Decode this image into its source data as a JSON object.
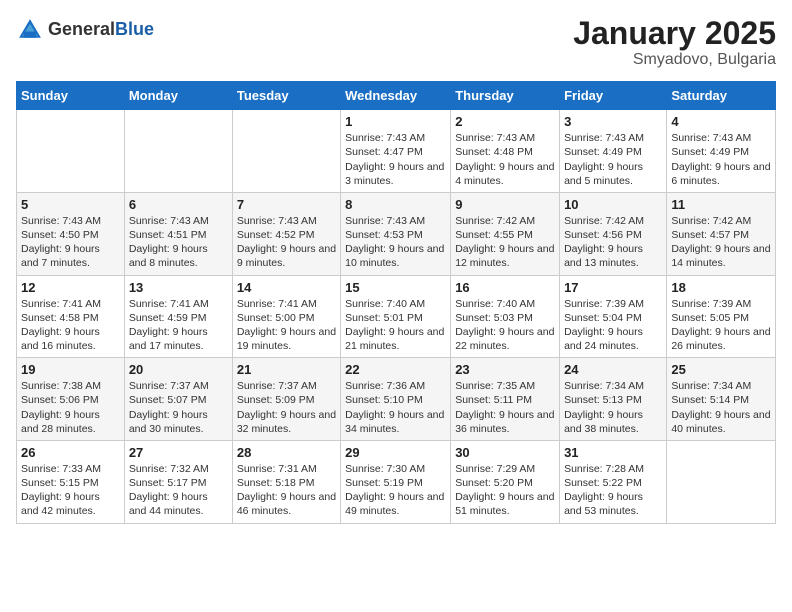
{
  "logo": {
    "text_general": "General",
    "text_blue": "Blue"
  },
  "title": "January 2025",
  "subtitle": "Smyadovo, Bulgaria",
  "weekdays": [
    "Sunday",
    "Monday",
    "Tuesday",
    "Wednesday",
    "Thursday",
    "Friday",
    "Saturday"
  ],
  "weeks": [
    [
      {
        "day": "",
        "text": ""
      },
      {
        "day": "",
        "text": ""
      },
      {
        "day": "",
        "text": ""
      },
      {
        "day": "1",
        "text": "Sunrise: 7:43 AM\nSunset: 4:47 PM\nDaylight: 9 hours and 3 minutes."
      },
      {
        "day": "2",
        "text": "Sunrise: 7:43 AM\nSunset: 4:48 PM\nDaylight: 9 hours and 4 minutes."
      },
      {
        "day": "3",
        "text": "Sunrise: 7:43 AM\nSunset: 4:49 PM\nDaylight: 9 hours and 5 minutes."
      },
      {
        "day": "4",
        "text": "Sunrise: 7:43 AM\nSunset: 4:49 PM\nDaylight: 9 hours and 6 minutes."
      }
    ],
    [
      {
        "day": "5",
        "text": "Sunrise: 7:43 AM\nSunset: 4:50 PM\nDaylight: 9 hours and 7 minutes."
      },
      {
        "day": "6",
        "text": "Sunrise: 7:43 AM\nSunset: 4:51 PM\nDaylight: 9 hours and 8 minutes."
      },
      {
        "day": "7",
        "text": "Sunrise: 7:43 AM\nSunset: 4:52 PM\nDaylight: 9 hours and 9 minutes."
      },
      {
        "day": "8",
        "text": "Sunrise: 7:43 AM\nSunset: 4:53 PM\nDaylight: 9 hours and 10 minutes."
      },
      {
        "day": "9",
        "text": "Sunrise: 7:42 AM\nSunset: 4:55 PM\nDaylight: 9 hours and 12 minutes."
      },
      {
        "day": "10",
        "text": "Sunrise: 7:42 AM\nSunset: 4:56 PM\nDaylight: 9 hours and 13 minutes."
      },
      {
        "day": "11",
        "text": "Sunrise: 7:42 AM\nSunset: 4:57 PM\nDaylight: 9 hours and 14 minutes."
      }
    ],
    [
      {
        "day": "12",
        "text": "Sunrise: 7:41 AM\nSunset: 4:58 PM\nDaylight: 9 hours and 16 minutes."
      },
      {
        "day": "13",
        "text": "Sunrise: 7:41 AM\nSunset: 4:59 PM\nDaylight: 9 hours and 17 minutes."
      },
      {
        "day": "14",
        "text": "Sunrise: 7:41 AM\nSunset: 5:00 PM\nDaylight: 9 hours and 19 minutes."
      },
      {
        "day": "15",
        "text": "Sunrise: 7:40 AM\nSunset: 5:01 PM\nDaylight: 9 hours and 21 minutes."
      },
      {
        "day": "16",
        "text": "Sunrise: 7:40 AM\nSunset: 5:03 PM\nDaylight: 9 hours and 22 minutes."
      },
      {
        "day": "17",
        "text": "Sunrise: 7:39 AM\nSunset: 5:04 PM\nDaylight: 9 hours and 24 minutes."
      },
      {
        "day": "18",
        "text": "Sunrise: 7:39 AM\nSunset: 5:05 PM\nDaylight: 9 hours and 26 minutes."
      }
    ],
    [
      {
        "day": "19",
        "text": "Sunrise: 7:38 AM\nSunset: 5:06 PM\nDaylight: 9 hours and 28 minutes."
      },
      {
        "day": "20",
        "text": "Sunrise: 7:37 AM\nSunset: 5:07 PM\nDaylight: 9 hours and 30 minutes."
      },
      {
        "day": "21",
        "text": "Sunrise: 7:37 AM\nSunset: 5:09 PM\nDaylight: 9 hours and 32 minutes."
      },
      {
        "day": "22",
        "text": "Sunrise: 7:36 AM\nSunset: 5:10 PM\nDaylight: 9 hours and 34 minutes."
      },
      {
        "day": "23",
        "text": "Sunrise: 7:35 AM\nSunset: 5:11 PM\nDaylight: 9 hours and 36 minutes."
      },
      {
        "day": "24",
        "text": "Sunrise: 7:34 AM\nSunset: 5:13 PM\nDaylight: 9 hours and 38 minutes."
      },
      {
        "day": "25",
        "text": "Sunrise: 7:34 AM\nSunset: 5:14 PM\nDaylight: 9 hours and 40 minutes."
      }
    ],
    [
      {
        "day": "26",
        "text": "Sunrise: 7:33 AM\nSunset: 5:15 PM\nDaylight: 9 hours and 42 minutes."
      },
      {
        "day": "27",
        "text": "Sunrise: 7:32 AM\nSunset: 5:17 PM\nDaylight: 9 hours and 44 minutes."
      },
      {
        "day": "28",
        "text": "Sunrise: 7:31 AM\nSunset: 5:18 PM\nDaylight: 9 hours and 46 minutes."
      },
      {
        "day": "29",
        "text": "Sunrise: 7:30 AM\nSunset: 5:19 PM\nDaylight: 9 hours and 49 minutes."
      },
      {
        "day": "30",
        "text": "Sunrise: 7:29 AM\nSunset: 5:20 PM\nDaylight: 9 hours and 51 minutes."
      },
      {
        "day": "31",
        "text": "Sunrise: 7:28 AM\nSunset: 5:22 PM\nDaylight: 9 hours and 53 minutes."
      },
      {
        "day": "",
        "text": ""
      }
    ]
  ]
}
